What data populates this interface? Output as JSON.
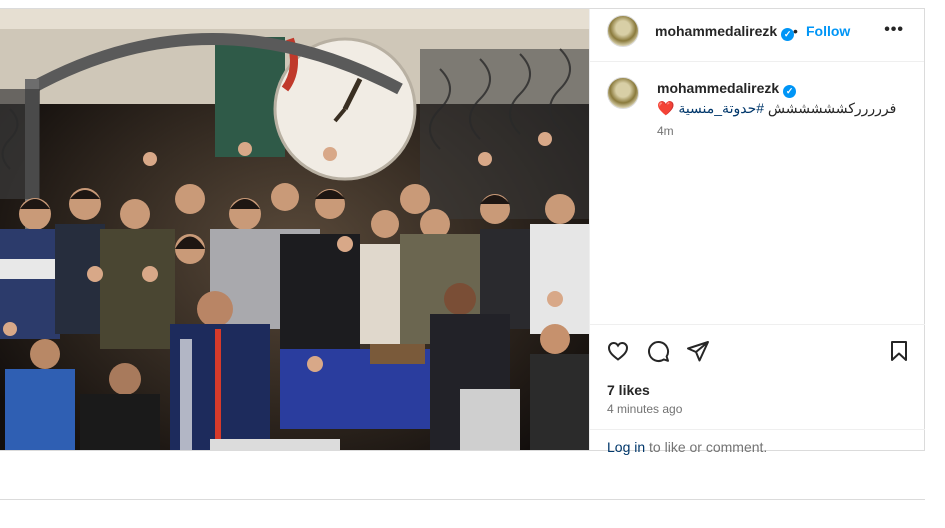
{
  "post": {
    "photo_alt": "",
    "header": {
      "username": "mohammedalirezk",
      "dot": "•",
      "follow_label": "Follow",
      "more_label": "•••"
    },
    "caption": {
      "username": "mohammedalirezk",
      "text": "فررررركشششششش",
      "hashtag": "#حدوتة_منسية",
      "emoji": "❤️",
      "time": "4m"
    },
    "actions": {
      "like_icon": "heart-icon",
      "comment_icon": "comment-icon",
      "share_icon": "paper-plane-icon",
      "save_icon": "bookmark-icon"
    },
    "likes": "7 likes",
    "ago": "4 minutes ago",
    "login": {
      "link": "Log in",
      "rest": " to like or comment."
    }
  },
  "colors": {
    "accent": "#0095f6",
    "link": "#00376b",
    "muted": "#737373",
    "heart": "#ed1c24"
  }
}
